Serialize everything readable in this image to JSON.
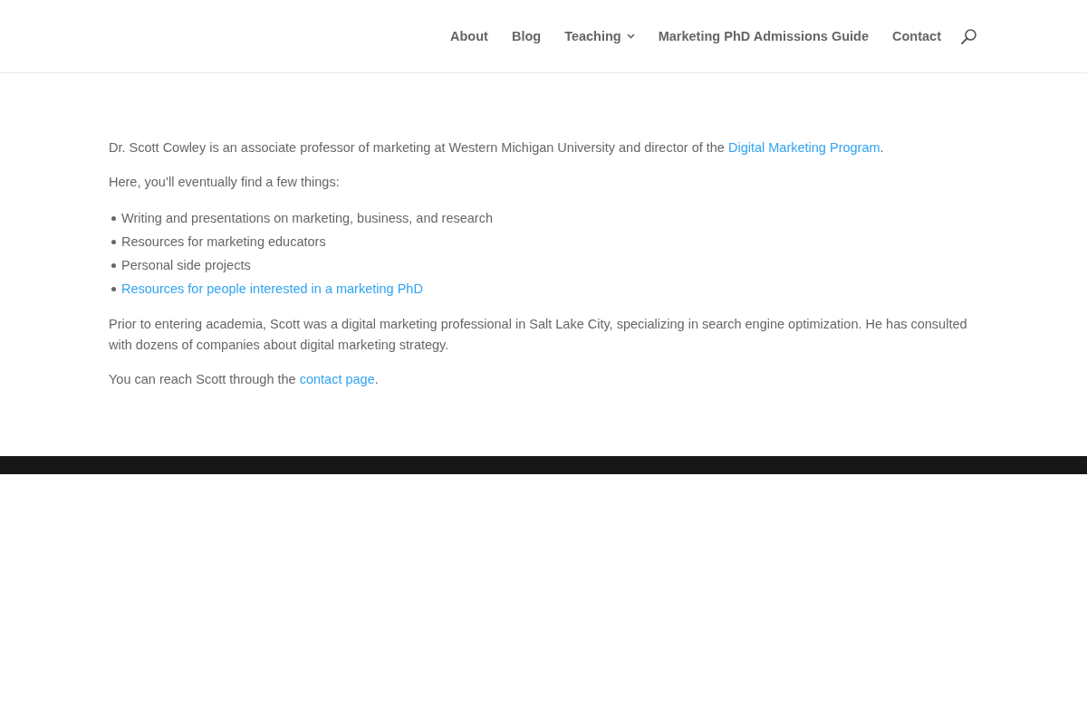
{
  "header": {
    "nav": [
      {
        "label": "About",
        "submenu": false
      },
      {
        "label": "Blog",
        "submenu": false
      },
      {
        "label": "Teaching",
        "submenu": true
      },
      {
        "label": "Marketing PhD Admissions Guide",
        "submenu": false
      },
      {
        "label": "Contact",
        "submenu": false
      }
    ]
  },
  "content": [
    {
      "kind": "paragraph",
      "parts": [
        {
          "kind": "text",
          "text": "Dr. Scott Cowley is an associate professor of marketing at Western Michigan University and director of the "
        },
        {
          "kind": "link",
          "text": "Digital Marketing Program"
        },
        {
          "kind": "text",
          "text": "."
        }
      ]
    },
    {
      "kind": "paragraph",
      "parts": [
        {
          "kind": "text",
          "text": "Here, you’ll eventually find a few things:"
        }
      ]
    },
    {
      "kind": "list",
      "items": [
        {
          "kind": "text",
          "text": "Writing and presentations on marketing, business, and research"
        },
        {
          "kind": "text",
          "text": "Resources for marketing educators"
        },
        {
          "kind": "text",
          "text": "Personal side projects"
        },
        {
          "kind": "link",
          "text": "Resources for people interested in a marketing PhD"
        }
      ]
    },
    {
      "kind": "paragraph",
      "parts": [
        {
          "kind": "text",
          "text": "Prior to entering academia, Scott was a digital marketing professional in Salt Lake City, specializing in search engine optimization. He has consulted with dozens of companies about digital marketing strategy."
        }
      ]
    },
    {
      "kind": "paragraph",
      "parts": [
        {
          "kind": "text",
          "text": "You can reach Scott through the "
        },
        {
          "kind": "link",
          "text": "contact page"
        },
        {
          "kind": "text",
          "text": "."
        }
      ]
    }
  ]
}
